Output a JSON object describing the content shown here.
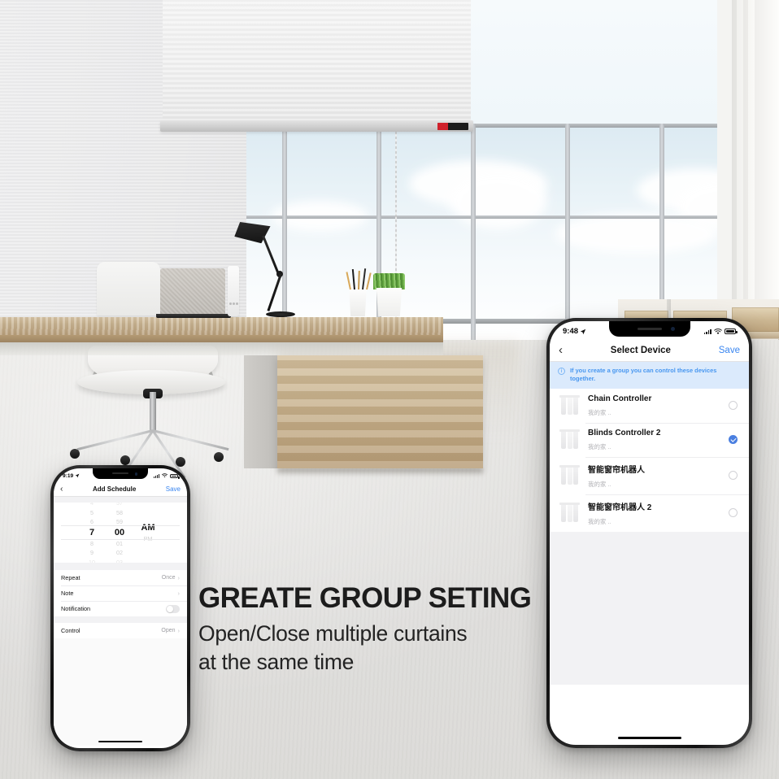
{
  "headline": {
    "title": "GREATE GROUP SETING",
    "line1": "Open/Close multiple curtains",
    "line2": "at the same time"
  },
  "colors": {
    "accent_blue": "#3a86f0",
    "checked_blue": "#4a7fe0",
    "banner_bg": "#dbeafc",
    "banner_text": "#4897f0"
  },
  "phone_right": {
    "status": {
      "time": "9:48",
      "location_icon": "location-arrow",
      "signal_icon": "cellular-bars",
      "wifi_icon": "wifi",
      "battery_icon": "battery-full"
    },
    "nav": {
      "back_icon": "chevron-left",
      "title": "Select Device",
      "action": "Save"
    },
    "banner": {
      "icon": "info-circle-icon",
      "text": "If you create a group you can control these devices together."
    },
    "devices": [
      {
        "icon": "blinds-icon",
        "name": "Chain Controller",
        "sub": "我的家 ..",
        "selected": false
      },
      {
        "icon": "blinds-icon",
        "name": "Blinds Controller 2",
        "sub": "我的家 ..",
        "selected": true
      },
      {
        "icon": "blinds-icon",
        "name": "智能窗帘机器人",
        "sub": "我的家 ..",
        "selected": false
      },
      {
        "icon": "blinds-icon",
        "name": "智能窗帘机器人 2",
        "sub": "我的家 ..",
        "selected": false
      }
    ]
  },
  "phone_left": {
    "status": {
      "time": "9:19",
      "location_icon": "location-arrow",
      "signal_icon": "cellular-bars",
      "wifi_icon": "wifi",
      "battery_icon": "battery-full"
    },
    "nav": {
      "back_icon": "chevron-left",
      "title": "Add Schedule",
      "action": "Save"
    },
    "picker": {
      "hours": [
        "4",
        "5",
        "6",
        "7",
        "8",
        "9",
        "10"
      ],
      "minutes": [
        "57",
        "58",
        "59",
        "00",
        "01",
        "02",
        "03"
      ],
      "meridiem": [
        "AM",
        "PM"
      ],
      "selected_hour": "7",
      "selected_minute": "00",
      "selected_meridiem": "AM"
    },
    "rows": [
      {
        "label": "Repeat",
        "value": "Once",
        "type": "chevron"
      },
      {
        "label": "Note",
        "value": "",
        "type": "chevron"
      },
      {
        "label": "Notification",
        "value": "off",
        "type": "toggle"
      },
      {
        "label": "Control",
        "value": "Open",
        "type": "chevron"
      }
    ]
  },
  "scene": {
    "blind_motor_icon": "curtain-motor-device",
    "objects": [
      "roller-blind",
      "window",
      "desk",
      "desk-lamp",
      "monitor",
      "laptop",
      "pencil-cup",
      "potted-plant",
      "office-chair",
      "bookshelf"
    ]
  }
}
